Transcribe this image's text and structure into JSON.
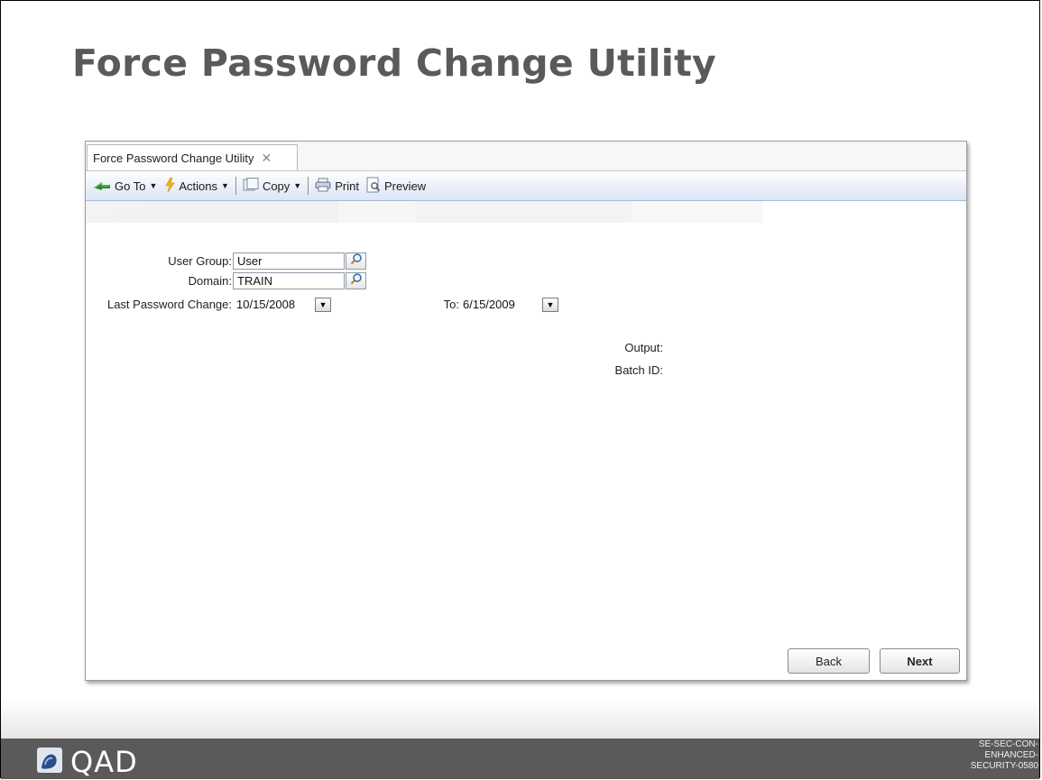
{
  "slide": {
    "title": "Force Password Change Utility"
  },
  "window": {
    "tab_label": "Force Password Change Utility",
    "tab_close": "✕"
  },
  "toolbar": {
    "goto_label": "Go To",
    "actions_label": "Actions",
    "copy_label": "Copy",
    "print_label": "Print",
    "preview_label": "Preview"
  },
  "form": {
    "user_group_label": "User Group:",
    "user_group_value": "User",
    "domain_label": "Domain:",
    "domain_value": "TRAIN",
    "last_pw_change_label": "Last Password Change:",
    "last_pw_change_from": "10/15/2008",
    "to_label": "To:",
    "last_pw_change_to": "6/15/2009",
    "output_label": "Output:",
    "batch_id_label": "Batch ID:"
  },
  "buttons": {
    "back_label": "Back",
    "next_label": "Next"
  },
  "footer": {
    "logo_text": "QAD",
    "doc_code": "SE-SEC-CON-ENHANCED-SECURITY-0580"
  },
  "colors": {
    "title": "#5a5a5a",
    "footer_bar": "#5a5a5a",
    "toolbar_accent": "#dde6f6"
  }
}
